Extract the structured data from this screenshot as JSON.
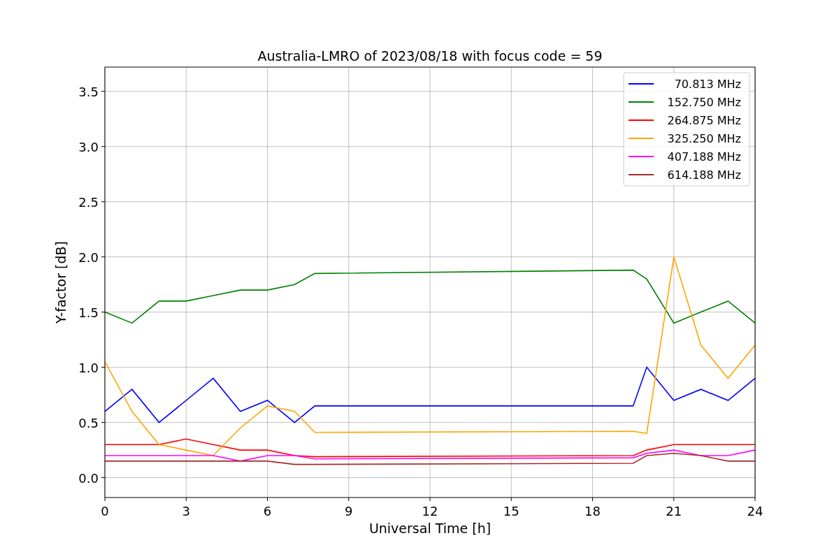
{
  "chart_data": {
    "type": "line",
    "title": "Australia-LMRO of 2023/08/18 with focus code = 59",
    "xlabel": "Universal Time [h]",
    "ylabel": "Y-factor [dB]",
    "x": [
      0,
      1,
      2,
      3,
      4,
      5,
      6,
      7,
      7.75,
      19.5,
      20,
      21,
      22,
      23,
      24
    ],
    "series": [
      {
        "name": "70.813 MHz",
        "color": "#0000ff",
        "values": [
          0.6,
          0.8,
          0.5,
          0.7,
          0.9,
          0.6,
          0.7,
          0.5,
          0.65,
          0.65,
          1.0,
          0.7,
          0.8,
          0.7,
          0.9
        ]
      },
      {
        "name": "152.750 MHz",
        "color": "#008000",
        "values": [
          1.5,
          1.4,
          1.6,
          1.6,
          1.65,
          1.7,
          1.7,
          1.75,
          1.85,
          1.88,
          1.8,
          1.4,
          1.5,
          1.6,
          1.4
        ]
      },
      {
        "name": "264.875 MHz",
        "color": "#ff0000",
        "values": [
          0.3,
          0.3,
          0.3,
          0.35,
          0.3,
          0.25,
          0.25,
          0.2,
          0.19,
          0.2,
          0.25,
          0.3,
          0.3,
          0.3,
          0.3
        ]
      },
      {
        "name": "325.250 MHz",
        "color": "#ffa500",
        "values": [
          1.05,
          0.6,
          0.3,
          0.25,
          0.2,
          0.45,
          0.65,
          0.6,
          0.41,
          0.42,
          0.4,
          2.0,
          1.2,
          0.9,
          1.2
        ]
      },
      {
        "name": "407.188 MHz",
        "color": "#ff00ff",
        "values": [
          0.2,
          0.2,
          0.2,
          0.2,
          0.2,
          0.15,
          0.2,
          0.2,
          0.17,
          0.18,
          0.22,
          0.25,
          0.2,
          0.2,
          0.25
        ]
      },
      {
        "name": "614.188 MHz",
        "color": "#a52a2a",
        "values": [
          0.15,
          0.15,
          0.15,
          0.15,
          0.15,
          0.15,
          0.15,
          0.12,
          0.12,
          0.13,
          0.2,
          0.22,
          0.2,
          0.15,
          0.15
        ]
      }
    ],
    "grid": true,
    "legend": true,
    "xlim": [
      0,
      24
    ],
    "ylim": [
      -0.18,
      3.72
    ],
    "xticks": [
      0,
      3,
      6,
      9,
      12,
      15,
      18,
      21,
      24
    ],
    "yticks": [
      {
        "value": 0,
        "label": "0.0"
      },
      {
        "value": 0.5,
        "label": "0.5"
      },
      {
        "value": 1,
        "label": "1.0"
      },
      {
        "value": 1.5,
        "label": "1.5"
      },
      {
        "value": 2,
        "label": "2.0"
      },
      {
        "value": 2.5,
        "label": "2.5"
      },
      {
        "value": 3,
        "label": "3.0"
      },
      {
        "value": 3.5,
        "label": "3.5"
      }
    ]
  }
}
